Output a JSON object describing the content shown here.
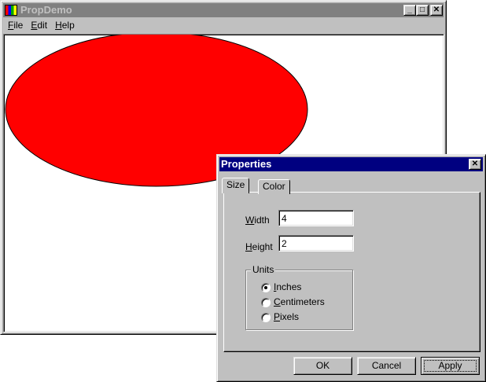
{
  "main_window": {
    "title": "PropDemo",
    "menu": [
      "File",
      "Edit",
      "Help"
    ],
    "ellipse_color": "#ff0000"
  },
  "dialog": {
    "title": "Properties",
    "tabs": [
      "Size",
      "Color"
    ],
    "active_tab": "Size",
    "width_label": "Width",
    "width_value": "4",
    "height_label": "Height",
    "height_value": "2",
    "units_label": "Units",
    "units": [
      "Inches",
      "Centimeters",
      "Pixels"
    ],
    "selected_unit": "Inches",
    "buttons": {
      "ok": "OK",
      "cancel": "Cancel",
      "apply": "Apply"
    }
  }
}
